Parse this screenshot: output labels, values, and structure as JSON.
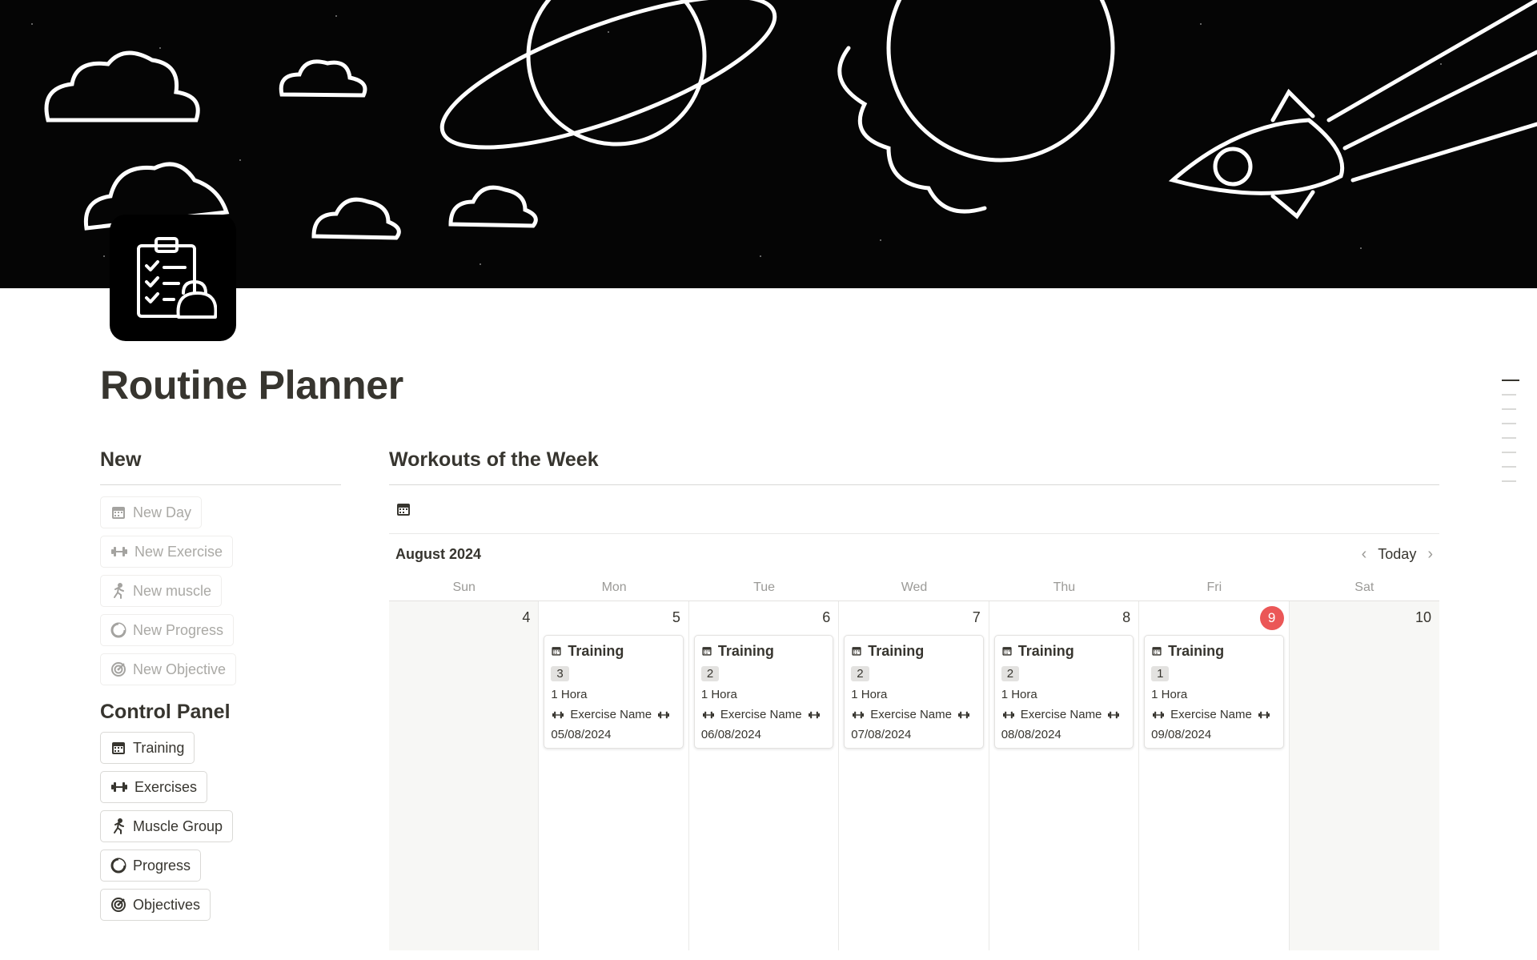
{
  "page": {
    "title": "Routine Planner"
  },
  "left": {
    "new_heading": "New",
    "new_buttons": [
      {
        "label": "New Day",
        "icon": "calendar-icon"
      },
      {
        "label": "New Exercise",
        "icon": "dumbbell-icon"
      },
      {
        "label": "New muscle",
        "icon": "runner-icon"
      },
      {
        "label": "New Progress",
        "icon": "pie-chart-icon"
      },
      {
        "label": "New Objective",
        "icon": "target-icon"
      }
    ],
    "control_heading": "Control Panel",
    "control_buttons": [
      {
        "label": "Training",
        "icon": "calendar-icon"
      },
      {
        "label": "Exercises",
        "icon": "dumbbell-icon"
      },
      {
        "label": "Muscle Group",
        "icon": "runner-icon"
      },
      {
        "label": "Progress",
        "icon": "pie-chart-icon"
      },
      {
        "label": "Objectives",
        "icon": "target-icon"
      }
    ]
  },
  "calendar": {
    "heading": "Workouts of the Week",
    "view_icon": "calendar-icon",
    "month": "August 2024",
    "today_label": "Today",
    "weekdays": [
      "Sun",
      "Mon",
      "Tue",
      "Wed",
      "Thu",
      "Fri",
      "Sat"
    ],
    "days": [
      {
        "num": "4",
        "weekend": true
      },
      {
        "num": "5",
        "event": {
          "title": "Training",
          "count": "3",
          "duration": "1 Hora",
          "exercise": "Exercise Name",
          "date": "05/08/2024"
        }
      },
      {
        "num": "6",
        "event": {
          "title": "Training",
          "count": "2",
          "duration": "1 Hora",
          "exercise": "Exercise Name",
          "date": "06/08/2024"
        }
      },
      {
        "num": "7",
        "event": {
          "title": "Training",
          "count": "2",
          "duration": "1 Hora",
          "exercise": "Exercise Name",
          "date": "07/08/2024"
        }
      },
      {
        "num": "8",
        "event": {
          "title": "Training",
          "count": "2",
          "duration": "1 Hora",
          "exercise": "Exercise Name",
          "date": "08/08/2024"
        }
      },
      {
        "num": "9",
        "today": true,
        "event": {
          "title": "Training",
          "count": "1",
          "duration": "1 Hora",
          "exercise": "Exercise Name",
          "date": "09/08/2024"
        }
      },
      {
        "num": "10",
        "weekend": true
      }
    ]
  },
  "colors": {
    "today_badge": "#eb5757",
    "text": "#37352f",
    "muted": "#9b9a97",
    "cover": "#050505"
  }
}
